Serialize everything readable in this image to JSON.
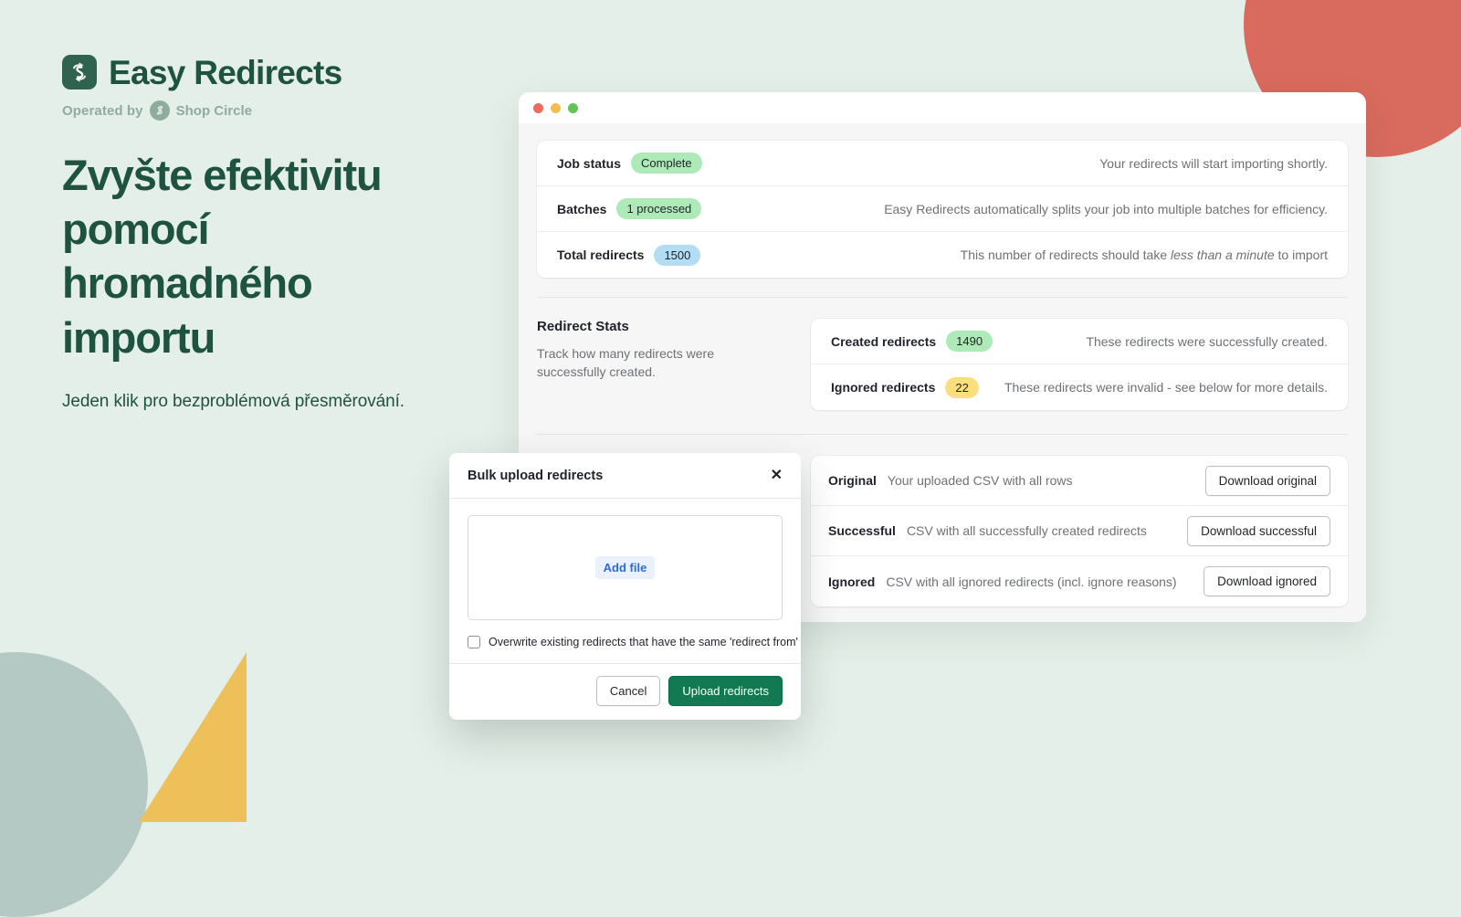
{
  "brand": {
    "name": "Easy Redirects",
    "logo_icon": "easy-redirects-logo-icon",
    "operated_by_label": "Operated by",
    "operator_name": "Shop Circle",
    "operator_icon": "shop-circle-icon",
    "accent_dark_green": "#1f5341",
    "logo_bg": "#2f6350"
  },
  "hero": {
    "headline": "Zvyšte efektivitu pomocí hromadného importu",
    "subhead": "Jeden klik pro bezproblémová přesměrování."
  },
  "window": {
    "traffic_lights": [
      {
        "name": "close-dot",
        "color": "#ec6a5e"
      },
      {
        "name": "minimize-dot",
        "color": "#f3bd4f"
      },
      {
        "name": "maximize-dot",
        "color": "#61c454"
      }
    ]
  },
  "status_rows": [
    {
      "label": "Job status",
      "badge": "Complete",
      "badge_color": "#aee9b8",
      "note": "Your redirects will start importing shortly.",
      "note_italic": "",
      "note_tail": ""
    },
    {
      "label": "Batches",
      "badge": "1 processed",
      "badge_color": "#aee9b8",
      "note": "Easy Redirects automatically splits your job into multiple batches for efficiency.",
      "note_italic": "",
      "note_tail": ""
    },
    {
      "label": "Total redirects",
      "badge": "1500",
      "badge_color": "#b3dcf5",
      "note": "This number of redirects should take ",
      "note_italic": "less than a minute",
      "note_tail": " to import"
    }
  ],
  "stats": {
    "title": "Redirect Stats",
    "description": "Track how many redirects were successfully created.",
    "rows": [
      {
        "label": "Created redirects",
        "badge": "1490",
        "badge_color": "#aee9b8",
        "note": "These redirects were successfully created."
      },
      {
        "label": "Ignored redirects",
        "badge": "22",
        "badge_color": "#fbdf7e",
        "note": "These redirects were invalid - see below for more details."
      }
    ]
  },
  "downloads": [
    {
      "label": "Original",
      "description": "Your uploaded CSV with all rows",
      "button": "Download original"
    },
    {
      "label": "Successful",
      "description": "CSV with all successfully created redirects",
      "button": "Download successful"
    },
    {
      "label": "Ignored",
      "description": "CSV with all ignored redirects (incl. ignore reasons)",
      "button": "Download ignored"
    }
  ],
  "modal": {
    "title": "Bulk upload redirects",
    "close_icon": "close-icon",
    "add_file_label": "Add file",
    "checkbox_label": "Overwrite existing redirects that have the same 'redirect from' URL.",
    "cancel_label": "Cancel",
    "submit_label": "Upload redirects",
    "primary_color": "#117a52",
    "add_file_color": "#2c6ecb"
  },
  "decor": {
    "red_circle": "#d96a5e",
    "sage_circle": "#b4c9c3",
    "yellow_triangle": "#eec05a",
    "page_background": "#e5efe9"
  }
}
